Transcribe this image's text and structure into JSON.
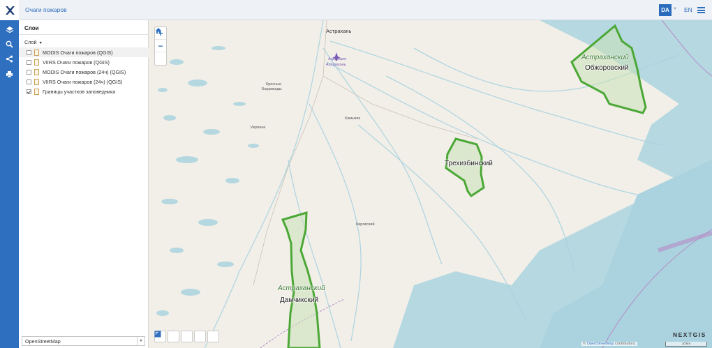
{
  "header": {
    "app_title": "Очаги пожаров",
    "user_initials": "DA",
    "language": "EN"
  },
  "toolbar": {
    "icons": [
      "layers-icon",
      "search-icon",
      "share-icon",
      "print-icon"
    ]
  },
  "layers_panel": {
    "title": "Слои",
    "layer_menu": "Слой",
    "layers": [
      {
        "label": "MODIS Очаги пожаров (QGIS)",
        "checked": false,
        "selected": true
      },
      {
        "label": "VIIRS Очаги пожаров (QGIS)",
        "checked": false,
        "selected": false
      },
      {
        "label": "MODIS Очаги пожаров (24ч) (QGIS)",
        "checked": false,
        "selected": false
      },
      {
        "label": "VIIRS Очаги пожаров (24ч) (QGIS)",
        "checked": false,
        "selected": false
      },
      {
        "label": "Границы участков заповедника",
        "checked": true,
        "selected": false
      }
    ],
    "basemap_value": "OpenStreetMap"
  },
  "map": {
    "place_labels": {
      "astrakhan": "Астрахань",
      "airport_1": "Аэропорт",
      "airport_2": "Астрахань",
      "krasnye_1": "Красные",
      "krasnye_2": "Баррикады",
      "ikryanoe": "Икряное",
      "kamyzyak": "Камызяк",
      "kirovsky": "Кировский"
    },
    "reserve_labels": {
      "obzhorovsky_italic": "Астраханский",
      "obzhorovsky": "Обжоровский",
      "trekhizbinsky": "Трехизбинский",
      "damchiksky_italic": "Астраханский",
      "damchiksky": "Дамчикский"
    },
    "brand": "NEXTGIS",
    "attribution_link": "OpenStreetMap",
    "attribution_rest": " contributors.",
    "scale": "10 km",
    "colors": {
      "water": "#aad3df",
      "land": "#f2efe9",
      "boundary": "#4ca836",
      "accent": "#2f6fbf"
    }
  }
}
